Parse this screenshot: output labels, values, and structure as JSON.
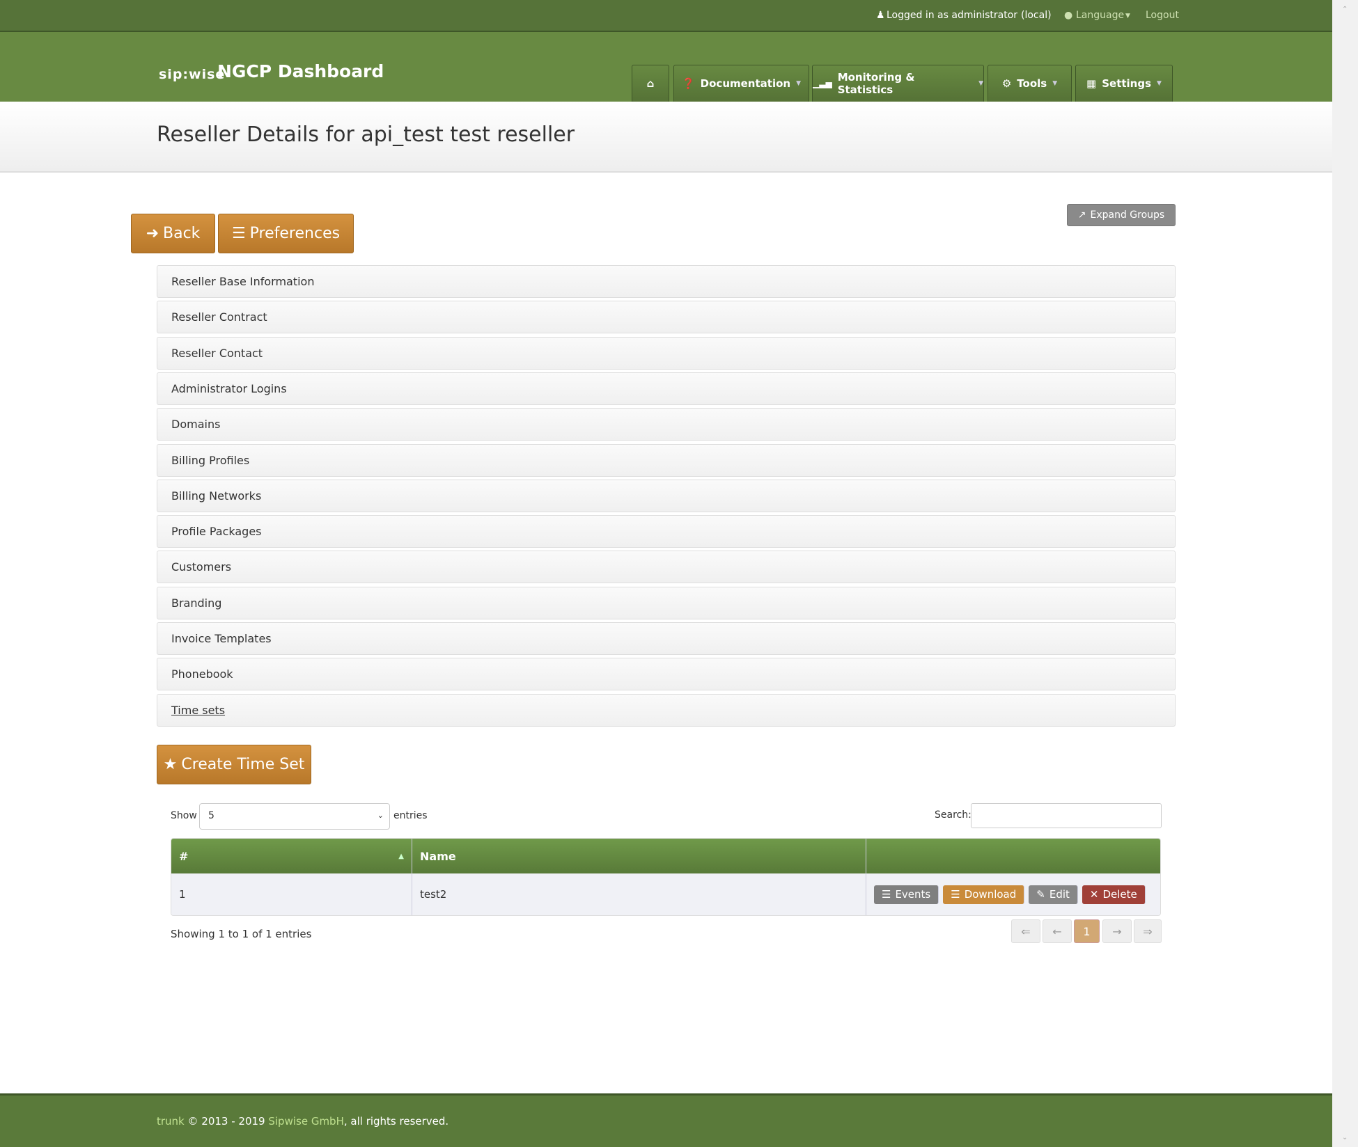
{
  "topbar": {
    "logged_in": "Logged in as administrator",
    "realm": "(local)",
    "language": "Language",
    "logout": "Logout"
  },
  "header": {
    "logo_text": "sip:wise",
    "title": "NGCP Dashboard",
    "nav": [
      {
        "label": "",
        "icon": "home-icon"
      },
      {
        "label": "Documentation",
        "icon": "question-icon"
      },
      {
        "label": "Monitoring & Statistics",
        "icon": "signal-icon"
      },
      {
        "label": "Tools",
        "icon": "gear-icon"
      },
      {
        "label": "Settings",
        "icon": "grid-icon"
      }
    ]
  },
  "page": {
    "title": "Reseller Details for api_test test reseller"
  },
  "buttons": {
    "back": "Back",
    "preferences": "Preferences",
    "expand_groups": "Expand Groups",
    "create": "Create Time Set"
  },
  "groups": [
    "Reseller Base Information",
    "Reseller Contract",
    "Reseller Contact",
    "Administrator Logins",
    "Domains",
    "Billing Profiles",
    "Billing Networks",
    "Profile Packages",
    "Customers",
    "Branding",
    "Invoice Templates",
    "Phonebook",
    "Time sets"
  ],
  "table_controls": {
    "show": "Show",
    "entries": "entries",
    "page_size": "5",
    "search": "Search:",
    "search_value": ""
  },
  "table": {
    "columns": [
      "#",
      "Name",
      ""
    ],
    "rows": [
      {
        "id": "1",
        "name": "test2"
      }
    ],
    "actions": {
      "events": "Events",
      "download": "Download",
      "edit": "Edit",
      "delete": "Delete"
    }
  },
  "showing": "Showing 1 to 1 of 1 entries",
  "pagination": {
    "first": "⇐",
    "prev": "←",
    "current": "1",
    "next": "→",
    "last": "⇒"
  },
  "footer": {
    "version": "trunk",
    "copyright": " © 2013 - 2019 ",
    "company": "Sipwise GmbH",
    "rights": ", all rights reserved."
  },
  "colors": {
    "topbar": "#567339",
    "header": "#688a42",
    "accent": "#c98a3a",
    "danger": "#a04038"
  }
}
